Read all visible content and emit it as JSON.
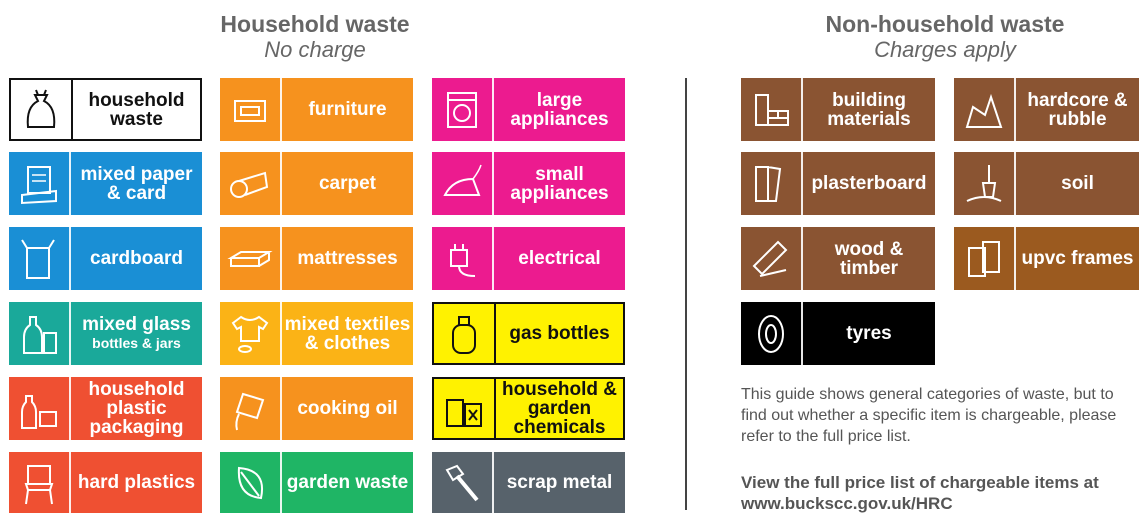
{
  "household": {
    "title": "Household waste",
    "subtitle": "No charge"
  },
  "nonhousehold": {
    "title": "Non-household waste",
    "subtitle": "Charges apply"
  },
  "colors": {
    "blue": "#1a8fd5",
    "teal": "#1aa99a",
    "red": "#ef5032",
    "orange": "#f6921e",
    "magenta": "#ec1b8f",
    "green": "#1fb565",
    "grey": "#57626b",
    "brown": "#8a5432",
    "tan": "#9b5a1f",
    "black": "#000000",
    "yellow": "#fff200"
  },
  "col1": {
    "household_waste": "household waste",
    "mixed_paper": "mixed paper & card",
    "cardboard": "cardboard",
    "mixed_glass": "mixed glass",
    "mixed_glass_sub": "bottles & jars",
    "plastic_packaging": "household plastic packaging",
    "hard_plastics": "hard plastics"
  },
  "col2": {
    "furniture": "furniture",
    "carpet": "carpet",
    "mattresses": "mattresses",
    "textiles": "mixed textiles & clothes",
    "cooking_oil": "cooking oil",
    "garden_waste": "garden waste"
  },
  "col3": {
    "large_appliances": "large appliances",
    "small_appliances": "small appliances",
    "electrical": "electrical",
    "gas_bottles": "gas bottles",
    "chemicals": "household & garden chemicals",
    "scrap_metal": "scrap metal"
  },
  "col4": {
    "building": "building materials",
    "plasterboard": "plasterboard",
    "wood": "wood & timber",
    "tyres": "tyres"
  },
  "col5": {
    "hardcore": "hardcore & rubble",
    "soil": "soil",
    "upvc": "upvc frames"
  },
  "note": "This guide shows general categories of waste, but to find out whether a specific item is chargeable, please refer to the full price list.",
  "link": "View the full price list of chargeable items at www.buckscc.gov.uk/HRC"
}
